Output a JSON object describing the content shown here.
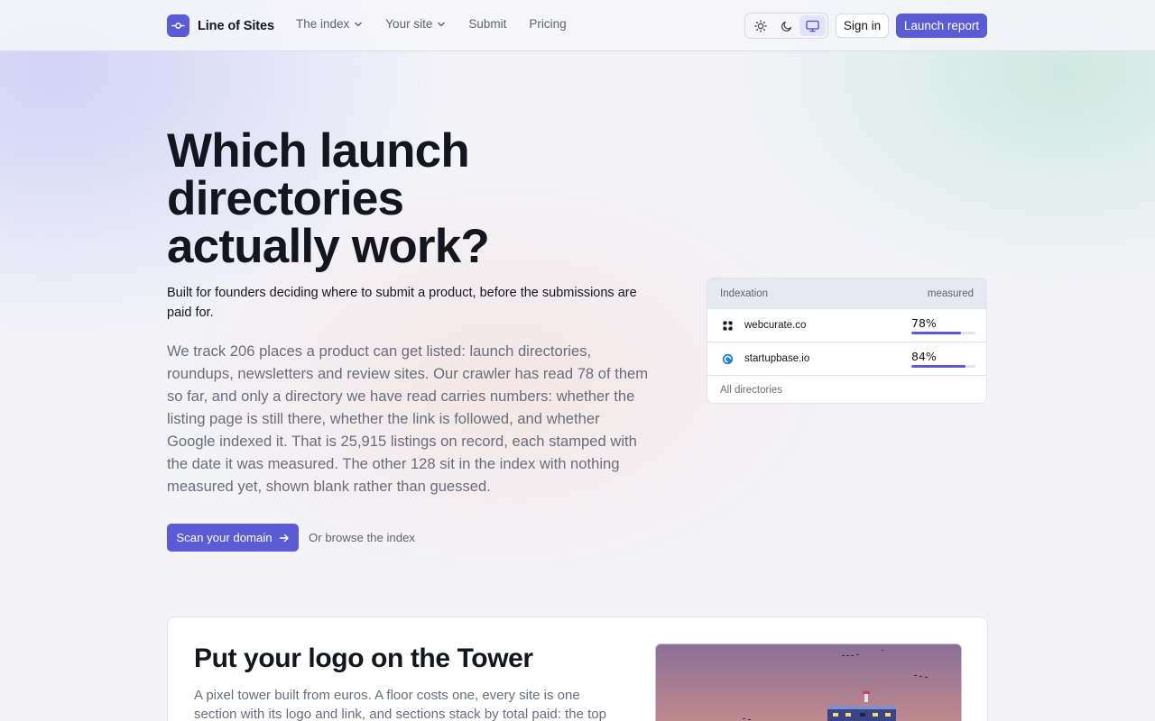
{
  "brand": {
    "name": "Line of Sites",
    "icon": "line-of-sites-logo-icon",
    "color": "#5b5bd6"
  },
  "nav": {
    "links": [
      {
        "label": "The index",
        "dropdown": true
      },
      {
        "label": "Your site",
        "dropdown": true
      },
      {
        "label": "Submit",
        "dropdown": false
      },
      {
        "label": "Pricing",
        "dropdown": false
      }
    ],
    "theme_options": [
      "sun-icon",
      "moon-icon",
      "monitor-icon"
    ],
    "theme_selected": "monitor-icon",
    "signin_label": "Sign in",
    "launch_label": "Launch report"
  },
  "hero": {
    "title_lines": [
      "Which launch",
      "directories",
      "actually work?"
    ],
    "subtitle": "Built for founders deciding where to submit a product, before the submissions are paid for.",
    "body": "We track 206 places a product can get listed: launch directories, roundups, newsletters and review sites. Our crawler has read 78 of them so far, and only a directory we have read carries numbers: whether the listing page is still there, whether the link is followed, and whether Google indexed it. That is 25,915 listings on record, each stamped with the date it was measured. The other 128 sit in the index with nothing measured yet, shown blank rather than guessed.",
    "cta_primary": "Scan your domain",
    "cta_secondary": "Or browse the index"
  },
  "indexation": {
    "header_left": "Indexation",
    "header_right": "measured",
    "rows": [
      {
        "site": "webcurate.co",
        "percent_label": "78%",
        "value": 78,
        "icon": "webcurate-icon"
      },
      {
        "site": "startupbase.io",
        "percent_label": "84%",
        "value": 84,
        "icon": "startupbase-icon"
      }
    ],
    "footer": "All directories"
  },
  "tower": {
    "title": "Put your logo on the Tower",
    "body": "A pixel tower built from euros. A floor costs one, every site is one section with its logo and link, and sections stack by total paid: the top"
  }
}
